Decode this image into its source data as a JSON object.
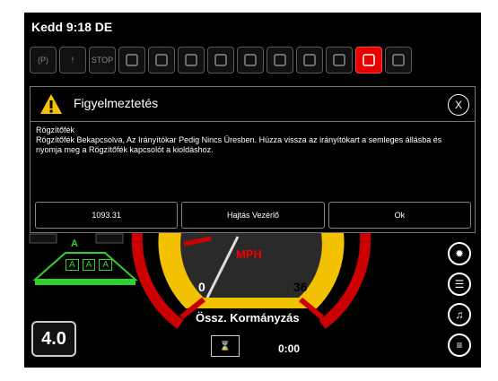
{
  "status": {
    "clock": "Kedd 9:18 DE"
  },
  "iconbar": [
    {
      "icon": "parking-icon",
      "label": "(P)"
    },
    {
      "icon": "warning-icon",
      "label": "!"
    },
    {
      "icon": "stop-icon",
      "label": "STOP"
    },
    {
      "icon": "tank-icon",
      "label": ""
    },
    {
      "icon": "water-icon",
      "label": ""
    },
    {
      "icon": "flow-icon",
      "label": ""
    },
    {
      "icon": "nozzle-icon",
      "label": ""
    },
    {
      "icon": "section-icon",
      "label": ""
    },
    {
      "icon": "pump-icon",
      "label": ""
    },
    {
      "icon": "valve-icon",
      "label": ""
    },
    {
      "icon": "agitator-icon",
      "label": ""
    },
    {
      "icon": "park-brake-icon",
      "label": "",
      "active": true
    },
    {
      "icon": "rinse-tank-icon",
      "label": ""
    }
  ],
  "dialog": {
    "title": "Figyelmeztetés",
    "close_label": "X",
    "heading": "Rögzítőfék",
    "message": "Rögzítőfék Bekapcsolva, Az Irányítókar Pedig Nincs Üresben. Húzza vissza az irányítókart a semleges állásba és nyomja meg a Rögzítőfék kapcsolót a kioldáshoz.",
    "buttons": [
      "1093.31",
      "Hajtás Vezérlő",
      "Ok"
    ]
  },
  "dashboard": {
    "gear": "4.0",
    "speed_unit": "MPH",
    "gauge_min": "0",
    "gauge_max": "36",
    "total_steering": "Össz. Kormányzás",
    "timer": "0:00",
    "boom_label": "A",
    "boom_sections": [
      "A",
      "A",
      "A"
    ]
  },
  "colors": {
    "accent": "#e80000",
    "warning": "#f5c400",
    "gauge": "#f2c200",
    "boom": "#2fd12f"
  }
}
